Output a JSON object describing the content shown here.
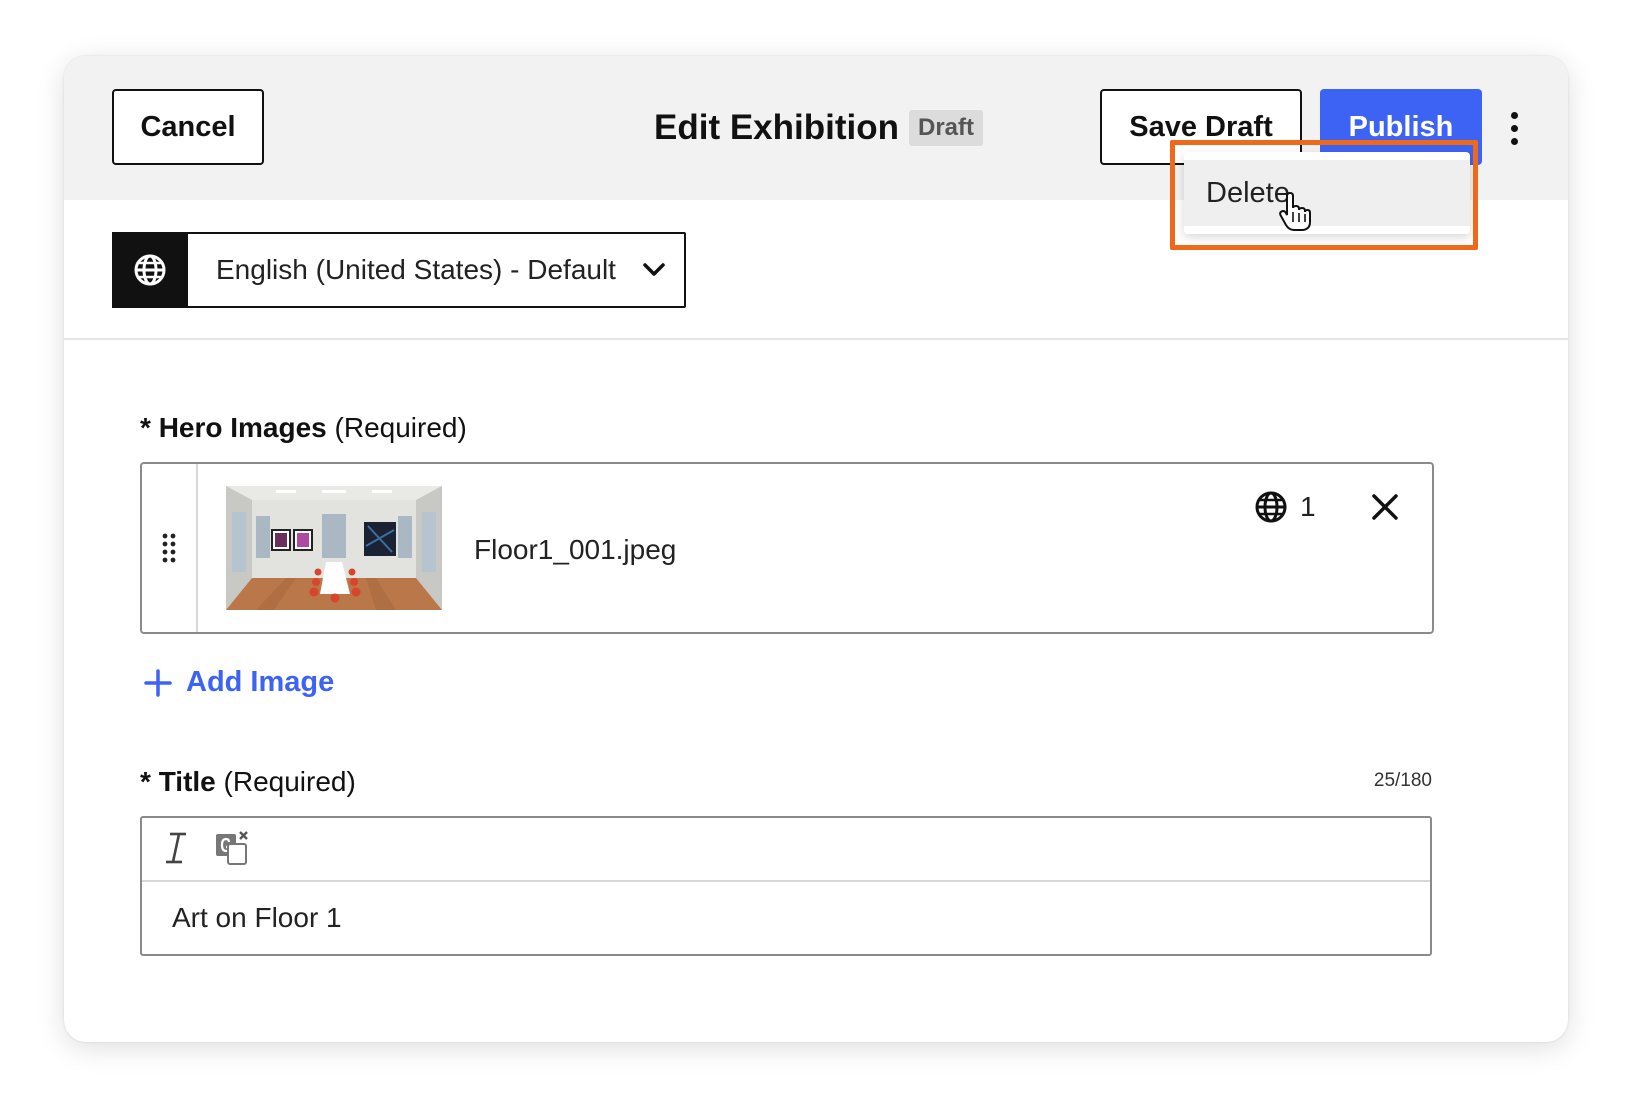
{
  "header": {
    "cancel_label": "Cancel",
    "title": "Edit Exhibition",
    "status_badge": "Draft",
    "save_draft_label": "Save Draft",
    "publish_label": "Publish",
    "more_icon": "more-vertical-icon"
  },
  "overflow_menu": {
    "items": [
      {
        "label": "Delete"
      }
    ]
  },
  "language_selector": {
    "icon": "globe-icon",
    "value": "English (United States) - Default"
  },
  "hero_images": {
    "label_prefix": "* ",
    "label": "Hero Images",
    "label_suffix": "(Required)",
    "items": [
      {
        "file_name": "Floor1_001.jpeg",
        "language_count": "1"
      }
    ],
    "add_label": "Add Image"
  },
  "title_field": {
    "label_prefix": "* ",
    "label": "Title",
    "label_suffix": "(Required)",
    "counter": "25/180",
    "value": "Art on Floor 1"
  },
  "colors": {
    "accent": "#3d63f5",
    "highlight": "#ee6a1a",
    "header_bg": "#f2f2f2"
  }
}
